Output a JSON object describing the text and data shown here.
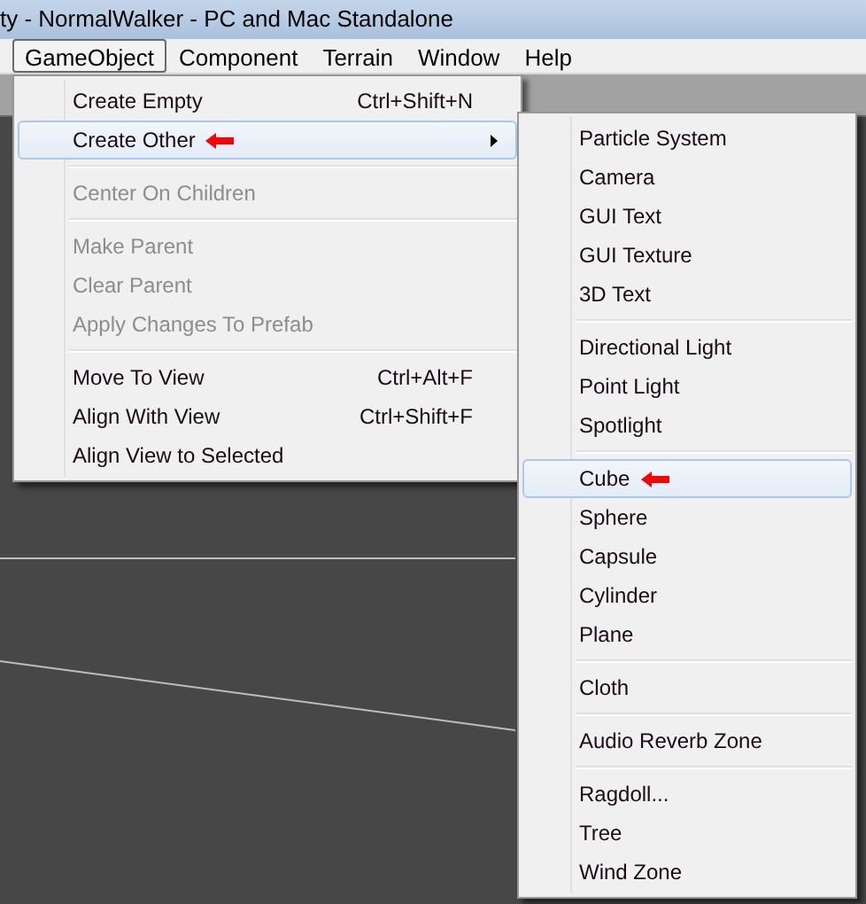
{
  "window": {
    "title": "ty - NormalWalker - PC and Mac Standalone"
  },
  "menubar": [
    {
      "label": "GameObject",
      "selected": true
    },
    {
      "label": "Component",
      "selected": false
    },
    {
      "label": "Terrain",
      "selected": false
    },
    {
      "label": "Window",
      "selected": false
    },
    {
      "label": "Help",
      "selected": false
    }
  ],
  "menu": [
    {
      "kind": "item",
      "label": "Create Empty",
      "shortcut": "Ctrl+Shift+N",
      "disabled": false,
      "selected": false,
      "submenu": false,
      "pointer": false
    },
    {
      "kind": "item",
      "label": "Create Other",
      "disabled": false,
      "selected": true,
      "submenu": true,
      "pointer": true
    },
    {
      "kind": "separator"
    },
    {
      "kind": "item",
      "label": "Center On Children",
      "disabled": true,
      "selected": false,
      "submenu": false,
      "pointer": false
    },
    {
      "kind": "separator"
    },
    {
      "kind": "item",
      "label": "Make Parent",
      "disabled": true,
      "selected": false,
      "submenu": false,
      "pointer": false
    },
    {
      "kind": "item",
      "label": "Clear Parent",
      "disabled": true,
      "selected": false,
      "submenu": false,
      "pointer": false
    },
    {
      "kind": "item",
      "label": "Apply Changes To Prefab",
      "disabled": true,
      "selected": false,
      "submenu": false,
      "pointer": false
    },
    {
      "kind": "separator"
    },
    {
      "kind": "item",
      "label": "Move To View",
      "shortcut": "Ctrl+Alt+F",
      "disabled": false,
      "selected": false,
      "submenu": false,
      "pointer": false
    },
    {
      "kind": "item",
      "label": "Align With View",
      "shortcut": "Ctrl+Shift+F",
      "disabled": false,
      "selected": false,
      "submenu": false,
      "pointer": false
    },
    {
      "kind": "item",
      "label": "Align View to Selected",
      "disabled": false,
      "selected": false,
      "submenu": false,
      "pointer": false
    }
  ],
  "submenu": [
    {
      "kind": "item",
      "label": "Particle System",
      "selected": false,
      "pointer": false
    },
    {
      "kind": "item",
      "label": "Camera",
      "selected": false,
      "pointer": false
    },
    {
      "kind": "item",
      "label": "GUI Text",
      "selected": false,
      "pointer": false
    },
    {
      "kind": "item",
      "label": "GUI Texture",
      "selected": false,
      "pointer": false
    },
    {
      "kind": "item",
      "label": "3D Text",
      "selected": false,
      "pointer": false
    },
    {
      "kind": "separator"
    },
    {
      "kind": "item",
      "label": "Directional Light",
      "selected": false,
      "pointer": false
    },
    {
      "kind": "item",
      "label": "Point Light",
      "selected": false,
      "pointer": false
    },
    {
      "kind": "item",
      "label": "Spotlight",
      "selected": false,
      "pointer": false
    },
    {
      "kind": "separator"
    },
    {
      "kind": "item",
      "label": "Cube",
      "selected": true,
      "pointer": true
    },
    {
      "kind": "item",
      "label": "Sphere",
      "selected": false,
      "pointer": false
    },
    {
      "kind": "item",
      "label": "Capsule",
      "selected": false,
      "pointer": false
    },
    {
      "kind": "item",
      "label": "Cylinder",
      "selected": false,
      "pointer": false
    },
    {
      "kind": "item",
      "label": "Plane",
      "selected": false,
      "pointer": false
    },
    {
      "kind": "separator"
    },
    {
      "kind": "item",
      "label": "Cloth",
      "selected": false,
      "pointer": false
    },
    {
      "kind": "separator"
    },
    {
      "kind": "item",
      "label": "Audio Reverb Zone",
      "selected": false,
      "pointer": false
    },
    {
      "kind": "separator"
    },
    {
      "kind": "item",
      "label": "Ragdoll...",
      "selected": false,
      "pointer": false
    },
    {
      "kind": "item",
      "label": "Tree",
      "selected": false,
      "pointer": false
    },
    {
      "kind": "item",
      "label": "Wind Zone",
      "selected": false,
      "pointer": false
    }
  ]
}
